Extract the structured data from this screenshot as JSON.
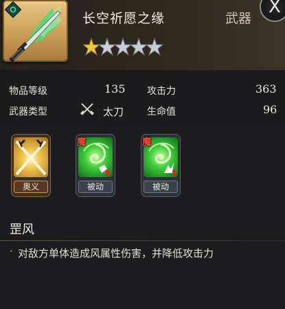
{
  "header": {
    "item_name": "长空祈愿之缘",
    "item_type": "武器",
    "close_glyph": "X",
    "star_rating": 1,
    "star_max": 5
  },
  "stats": {
    "level_label": "物品等级",
    "level_value": "135",
    "attack_label": "攻击力",
    "attack_value": "363",
    "weapon_type_label": "武器类型",
    "weapon_type_value": "太刀",
    "hp_label": "生命值",
    "hp_value": "96"
  },
  "skills": [
    {
      "label": "奥义",
      "icon": "crossed-swords-icon"
    },
    {
      "label": "被动",
      "badge": "魔",
      "icon": "wind-swirl-icon"
    },
    {
      "label": "被动",
      "badge": "魔",
      "icon": "wind-swirl-icon"
    }
  ],
  "description": {
    "title": "罡风",
    "bullet": "·",
    "text": "对敌方单体造成风属性伤害，并降低攻击力"
  },
  "colors": {
    "gold_frame": "#c69a52",
    "star_gold": "#f2c544",
    "star_silver": "#c9ced6",
    "mo_red": "#ff4a3a",
    "wind_green": "#3fcf3a"
  }
}
